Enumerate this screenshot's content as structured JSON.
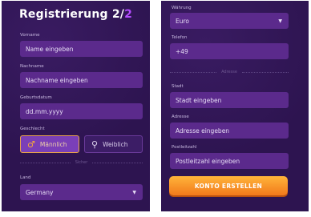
{
  "step_title": {
    "text": "Registrierung",
    "current": "2",
    "separator": "/",
    "total": "2"
  },
  "left": {
    "vorname": {
      "label": "Vorname",
      "placeholder": "Name eingeben"
    },
    "nachname": {
      "label": "Nachname",
      "placeholder": "Nachname eingeben"
    },
    "geburtsdatum": {
      "label": "Geburtsdatum",
      "placeholder": "dd.mm.yyyy"
    },
    "geschlecht": {
      "label": "Geschlecht",
      "male": "Männlich",
      "female": "Weiblich",
      "selected": "Männlich"
    },
    "divider": "Sicher",
    "land": {
      "label": "Land",
      "value": "Germany"
    }
  },
  "right": {
    "waehrung": {
      "label": "Währung",
      "value": "Euro"
    },
    "telefon": {
      "label": "Telefon",
      "value": "+49"
    },
    "divider": "Adresse",
    "stadt": {
      "label": "Stadt",
      "placeholder": "Stadt eingeben"
    },
    "adresse": {
      "label": "Adresse",
      "placeholder": "Adresse eingeben"
    },
    "postleitzahl": {
      "label": "Postleitzahl",
      "placeholder": "Postleitzahl eingeben"
    },
    "submit_label": "KONTO ERSTELLEN"
  },
  "colors": {
    "panel_bg": "#2d1450",
    "field_bg": "#5b2a8c",
    "accent": "#b44cff",
    "cta": "#f7941d",
    "selected_border": "#e8a24a"
  },
  "icons": {
    "male": "male-symbol-icon",
    "female": "search-icon",
    "dropdown": "chevron-down-icon"
  }
}
